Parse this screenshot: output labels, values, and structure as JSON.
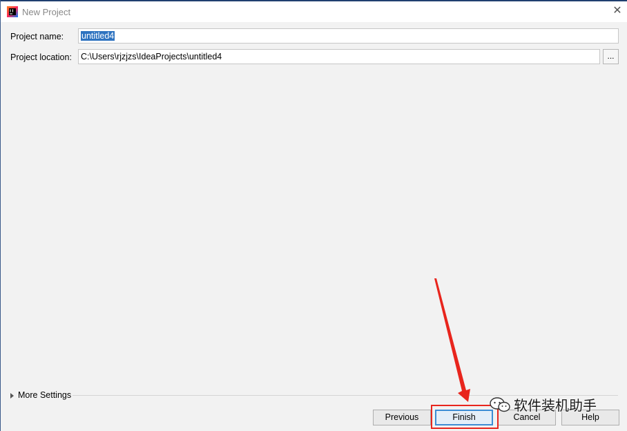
{
  "window": {
    "title": "New Project",
    "close_glyph": "✕"
  },
  "form": {
    "name_label": "Project name:",
    "name_value": "untitled4",
    "location_label": "Project location:",
    "location_value": "C:\\Users\\rjzjzs\\IdeaProjects\\untitled4",
    "browse_label": "..."
  },
  "more_settings": {
    "label": "More Settings",
    "expanded": false
  },
  "buttons": {
    "previous": "Previous",
    "finish": "Finish",
    "cancel": "Cancel",
    "help": "Help"
  },
  "watermark": {
    "text": "软件装机助手"
  },
  "colors": {
    "annotation": "#e8251d",
    "selection": "#2e73c0",
    "default_button_border": "#3c8cd4"
  },
  "icons": {
    "app": "intellij-idea-icon",
    "close": "close-icon",
    "expand": "chevron-right-icon",
    "watermark": "wechat-icon"
  }
}
